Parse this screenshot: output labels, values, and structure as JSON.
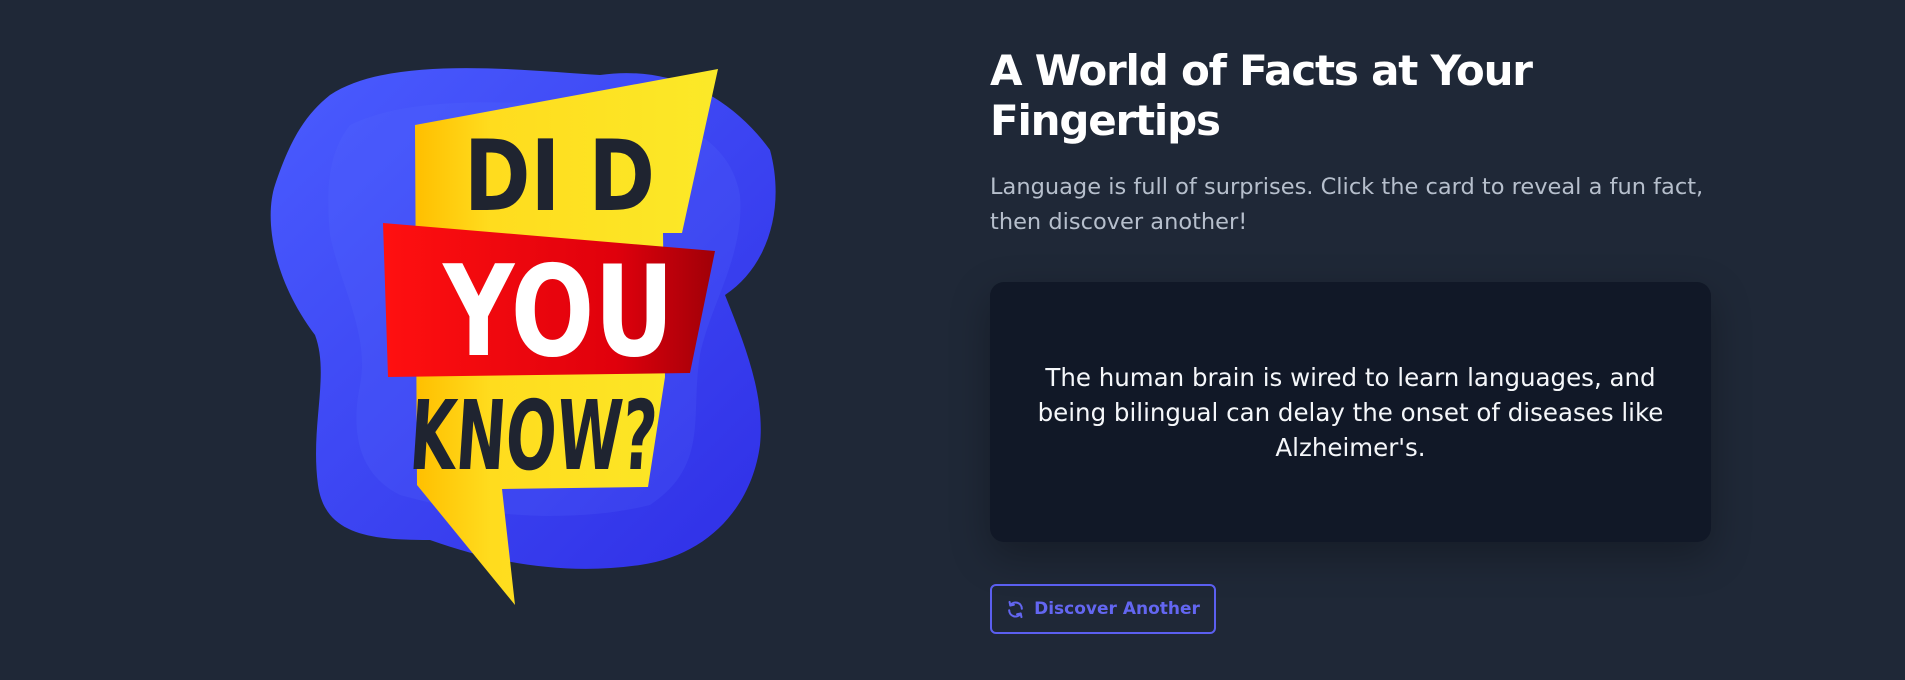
{
  "illustration": {
    "lines": [
      "DI D",
      "YOU",
      "KNOW?"
    ],
    "colors": {
      "blob": "#3b45f2",
      "bubble": "#ffd81a",
      "banner": "#e8000d",
      "dark_text": "#1f2430",
      "light_text": "#ffffff"
    }
  },
  "hero": {
    "title": "A World of Facts at Your Fingertips",
    "subtitle": "Language is full of surprises. Click the card to reveal a fun fact, then discover another!"
  },
  "fact_card": {
    "text": "The human brain is wired to learn languages, and being bilingual can delay the onset of diseases like Alzheimer's."
  },
  "actions": {
    "discover_label": "Discover Another",
    "discover_icon": "refresh-icon",
    "accent": "#6366f1"
  }
}
